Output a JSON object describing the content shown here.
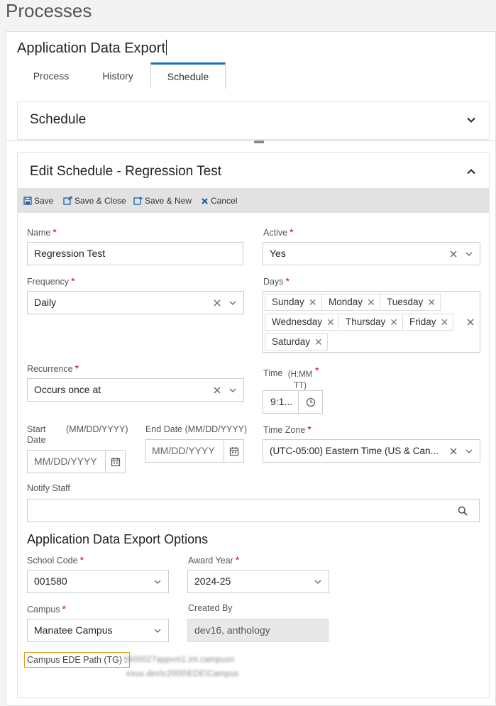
{
  "page": {
    "title": "Processes"
  },
  "process": {
    "title": "Application Data Export"
  },
  "tabs": [
    {
      "label": "Process"
    },
    {
      "label": "History"
    },
    {
      "label": "Schedule"
    }
  ],
  "schedule_section": {
    "title": "Schedule"
  },
  "edit_section": {
    "title": "Edit Schedule - Regression Test"
  },
  "toolbar": {
    "save": "Save",
    "save_close": "Save & Close",
    "save_new": "Save & New",
    "cancel": "Cancel"
  },
  "form": {
    "name": {
      "label": "Name",
      "value": "Regression Test"
    },
    "active": {
      "label": "Active",
      "value": "Yes"
    },
    "frequency": {
      "label": "Frequency",
      "value": "Daily"
    },
    "days": {
      "label": "Days",
      "selected": [
        "Sunday",
        "Monday",
        "Tuesday",
        "Wednesday",
        "Thursday",
        "Friday",
        "Saturday"
      ]
    },
    "recurrence": {
      "label": "Recurrence",
      "value": "Occurs once at"
    },
    "time": {
      "label": "Time",
      "hint_line1": "(H:MM",
      "hint_line2": "TT)",
      "value": "9:1..."
    },
    "start_date": {
      "label_line1": "Start",
      "label_line2": "Date",
      "hint": "(MM/DD/YYYY)",
      "placeholder": "MM/DD/YYYY"
    },
    "end_date": {
      "label": "End Date",
      "hint": "(MM/DD/YYYY)",
      "placeholder": "MM/DD/YYYY"
    },
    "time_zone": {
      "label": "Time Zone",
      "value": "(UTC-05:00) Eastern Time (US & Can..."
    },
    "notify_staff": {
      "label": "Notify Staff",
      "value": ""
    }
  },
  "options": {
    "title": "Application Data Export Options",
    "school_code": {
      "label": "School Code",
      "value": "001580"
    },
    "award_year": {
      "label": "Award Year",
      "value": "2024-25"
    },
    "campus": {
      "label": "Campus",
      "value": "Manatee Campus"
    },
    "created_by": {
      "label": "Created By",
      "value": "dev16, anthology"
    },
    "campus_ede_path": {
      "label": "Campus EDE Path (TG) :",
      "value_line1": "\\\\600027appvm1.int.campusn",
      "value_line2": "exus.dev\\c2000\\EDE\\Campus"
    }
  },
  "colors": {
    "accent": "#1e6ebf",
    "required": "#d0021b",
    "toolbar_bg": "#e2e2e2",
    "highlight_border": "#e0a020"
  },
  "icons": [
    "save-icon",
    "save-close-icon",
    "save-new-icon",
    "cancel-icon",
    "chevron-down-icon",
    "chevron-up-icon",
    "clear-icon",
    "dropdown-icon",
    "clock-icon",
    "calendar-icon",
    "search-icon"
  ]
}
